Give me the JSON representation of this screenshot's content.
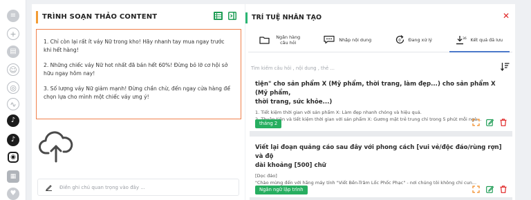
{
  "sidebar": {
    "icons": [
      "database-icon",
      "plus-circle-icon",
      "document-icon",
      "smile-icon",
      "compass-icon",
      "wave-icon",
      "tiktok-icon",
      "tiktok-alt-icon",
      "instagram-icon",
      "calendar-icon",
      "shield-icon"
    ]
  },
  "editor": {
    "title": "TRÌNH SOẠN THẢO CONTENT",
    "paragraphs": [
      "1. Chỉ còn lại rất ít váy Nữ trong kho! Hãy nhanh tay mua ngay trước khi hết hàng!",
      "2. Những chiếc váy Nữ hot nhất đã bán hết 60%! Đừng bỏ lỡ cơ hội sở hữu ngay hôm nay!",
      "3. Số lượng váy Nữ giảm mạnh! Đừng chần chừ, đến ngay cửa hàng để chọn lựa cho mình một chiếc váy ưng ý!"
    ],
    "note_placeholder": "Điền ghi chú quan trọng vào đây ..."
  },
  "ai": {
    "title": "TRÍ TUỆ NHÂN TẠO",
    "close": "✕",
    "tabs": [
      {
        "label": "Ngân hàng câu hỏi",
        "icon": "folder-icon"
      },
      {
        "label": "Nhập nội dung",
        "icon": "chat-icon"
      },
      {
        "label": "Đang xử lý",
        "icon": "refresh-icon"
      },
      {
        "label": "Kết quả đã lưu",
        "icon": "download-icon"
      }
    ],
    "search_placeholder": "Tìm kiếm câu hỏi , nội dung , thẻ ...",
    "results": [
      {
        "title_lines": [
          "tiện\" cho sản phẩm X (Mỹ phẩm, thời trang, làm đẹp...) cho sản phẩm X (Mỹ phẩm,",
          "thời trang, sức khỏe...)"
        ],
        "body": [
          "1. Tiết kiệm thời gian với sản phẩm X: Làm đẹp nhanh chóng và hiệu quả.",
          "2. Thuận tiện và tiết kiệm thời gian với sản phẩm X: Gương mặt trẻ trung chỉ trong 5 phút mỗi ngà..."
        ],
        "tag": "tháng 2"
      },
      {
        "title_lines": [
          "Viết lại đoạn quảng cáo sau đây với phong cách [vui vẻ/độc đáo/rùng rợn] và độ",
          "dài khoảng [500] chữ"
        ],
        "body": [
          "[Dọc đáo]",
          "\"Chào mừng đến với hãng máy tính \"Viết Bền-Trâm Lốc Phốc Phạc\" - nơi chúng tôi không chỉ cun..."
        ],
        "tag": "Ngân ngữ lập trình"
      }
    ]
  },
  "colors": {
    "accent_orange": "#f39c34",
    "accent_green": "#2bb673",
    "tag_green": "#27ae60",
    "danger_red": "#e02424",
    "tab_underline": "#4a78c9"
  }
}
